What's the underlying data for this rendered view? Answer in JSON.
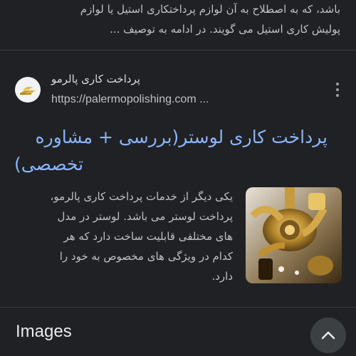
{
  "prev_snippet": {
    "line1": "باشد، که به اصطلاح به آن لوازم پرداختکاری استیل یا لوازم",
    "line2": "پولیش کاری استیل می گویند. در ادامه به توصیف ..."
  },
  "result": {
    "site_name": "پرداخت کاری پالرمو",
    "url": "https://palermopolishing.com ...",
    "title_line1": "پرداخت کاری لوستر(بررسی + مشاوره",
    "title_line2": "تخصصی)",
    "description": [
      "یکی دیگر از خدمات پرداخت کاری پالرمو،",
      "پرداخت لوستر می باشد. لوستر در مدل",
      "های مختلفی قابلیت ساخت دارد که هر",
      "کدام در ویژگی های مخصوص به خود را",
      "دارد."
    ],
    "thumbnail_icon": "brass-chandelier-photo",
    "favicon_icon": "gold-bars-logo"
  },
  "images_section": {
    "title": "Images",
    "collapse_icon": "chevron-up-icon"
  },
  "colors": {
    "background": "#202124",
    "link": "#8ab4f8",
    "text": "#bdc1c6"
  }
}
